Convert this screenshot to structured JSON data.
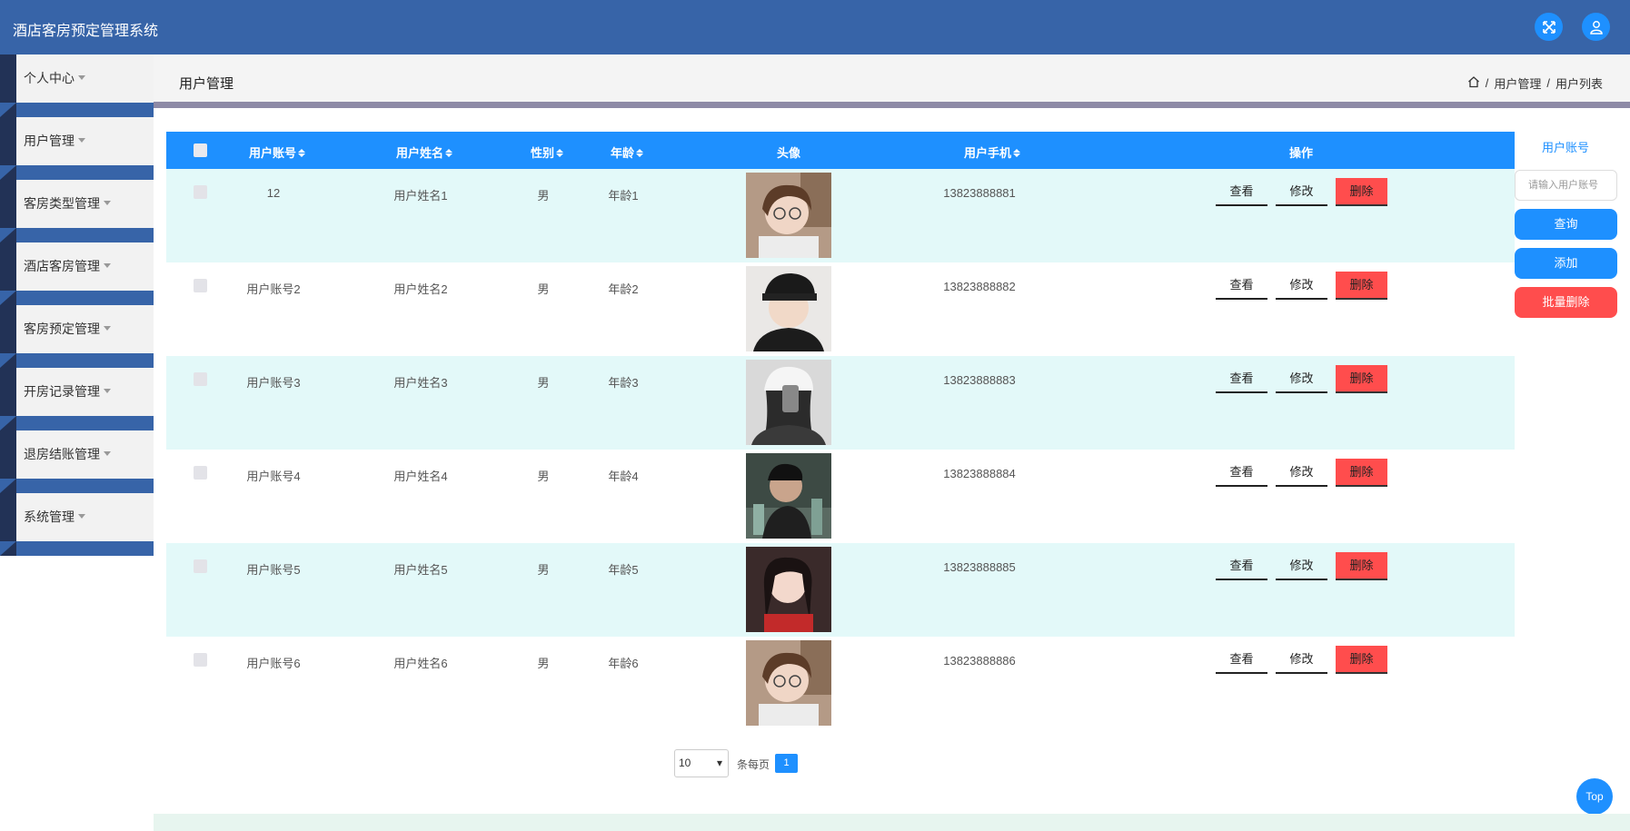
{
  "header": {
    "title": "酒店客房预定管理系统"
  },
  "sidebar": {
    "items": [
      {
        "label": "个人中心"
      },
      {
        "label": "用户管理"
      },
      {
        "label": "客房类型管理"
      },
      {
        "label": "酒店客房管理"
      },
      {
        "label": "客房预定管理"
      },
      {
        "label": "开房记录管理"
      },
      {
        "label": "退房结账管理"
      },
      {
        "label": "系统管理"
      }
    ]
  },
  "page": {
    "title": "用户管理",
    "breadcrumb": [
      "用户管理",
      "用户列表"
    ],
    "separator": "/"
  },
  "table": {
    "headers": {
      "account": "用户账号",
      "name": "用户姓名",
      "gender": "性别",
      "age": "年龄",
      "avatar": "头像",
      "phone": "用户手机",
      "actions": "操作"
    },
    "rows": [
      {
        "account": "12",
        "name": "用户姓名1",
        "gender": "男",
        "age": "年龄1",
        "phone": "13823888881"
      },
      {
        "account": "用户账号2",
        "name": "用户姓名2",
        "gender": "男",
        "age": "年龄2",
        "phone": "13823888882"
      },
      {
        "account": "用户账号3",
        "name": "用户姓名3",
        "gender": "男",
        "age": "年龄3",
        "phone": "13823888883"
      },
      {
        "account": "用户账号4",
        "name": "用户姓名4",
        "gender": "男",
        "age": "年龄4",
        "phone": "13823888884"
      },
      {
        "account": "用户账号5",
        "name": "用户姓名5",
        "gender": "男",
        "age": "年龄5",
        "phone": "13823888885"
      },
      {
        "account": "用户账号6",
        "name": "用户姓名6",
        "gender": "男",
        "age": "年龄6",
        "phone": "13823888886"
      }
    ],
    "actions": {
      "view": "查看",
      "edit": "修改",
      "delete": "删除"
    }
  },
  "search": {
    "label": "用户账号",
    "placeholder": "请输入用户账号",
    "query_btn": "查询",
    "add_btn": "添加",
    "batch_delete_btn": "批量删除"
  },
  "pagination": {
    "page_size": "10",
    "per_page_label": "条每页",
    "current_page": "1"
  },
  "top_button": "Top",
  "colors": {
    "primary": "#1e90ff",
    "header": "#3764a8",
    "danger": "#ff4d4d",
    "row_alt": "#e3f9f9"
  }
}
